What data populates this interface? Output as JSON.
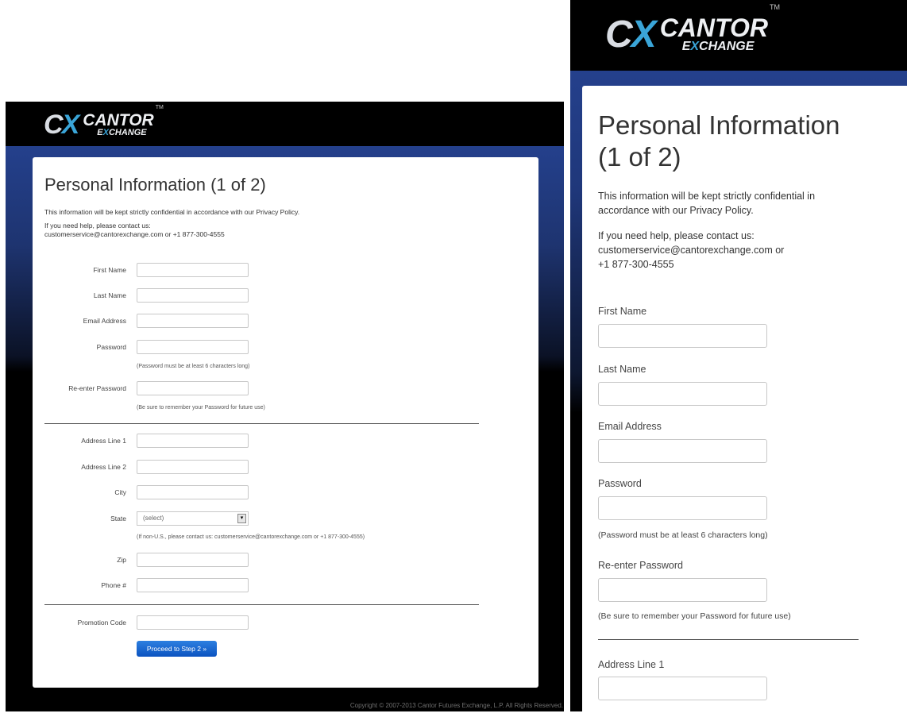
{
  "brand": {
    "logo_mark_c": "C",
    "logo_mark_x": "X",
    "word1": "CANTOR",
    "word2_e": "E",
    "word2_x": "X",
    "word2_rest": "CHANGE",
    "tm": "TM"
  },
  "page": {
    "title": "Personal Information (1 of 2)",
    "title_line1": "Personal Information",
    "title_line2": "(1 of 2)",
    "confidential": "This information will be kept strictly confidential in accordance with our Privacy Policy.",
    "help_intro": "If you need help, please contact us:",
    "help_contact": "customerservice@cantorexchange.com or +1 877-300-4555",
    "help_email_m": "customerservice@cantorexchange.com or",
    "help_phone_m": "+1 877-300-4555"
  },
  "form": {
    "first_name": "First Name",
    "last_name": "Last Name",
    "email": "Email Address",
    "password": "Password",
    "password_hint": "(Password must be at least 6 characters long)",
    "reenter_password": "Re-enter Password",
    "reenter_hint": "(Be sure to remember your Password for future use)",
    "address1": "Address Line 1",
    "address2": "Address Line 2",
    "city": "City",
    "state": "State",
    "state_selected": "(select)",
    "state_hint": "(If non-U.S., please contact us: customerservice@cantorexchange.com or +1 877-300-4555)",
    "zip": "Zip",
    "phone": "Phone #",
    "promo": "Promotion Code",
    "submit": "Proceed to Step 2 »"
  },
  "footer": {
    "copyright": "Copyright © 2007-2013 Cantor Futures Exchange, L.P. All Rights Reserved."
  },
  "colors": {
    "header_bg": "#000000",
    "band_blue": "#24408c",
    "button_blue": "#0b53c0",
    "logo_accent": "#3aa5d8"
  },
  "icons": {
    "select_arrow": "dropdown-arrow-icon"
  }
}
